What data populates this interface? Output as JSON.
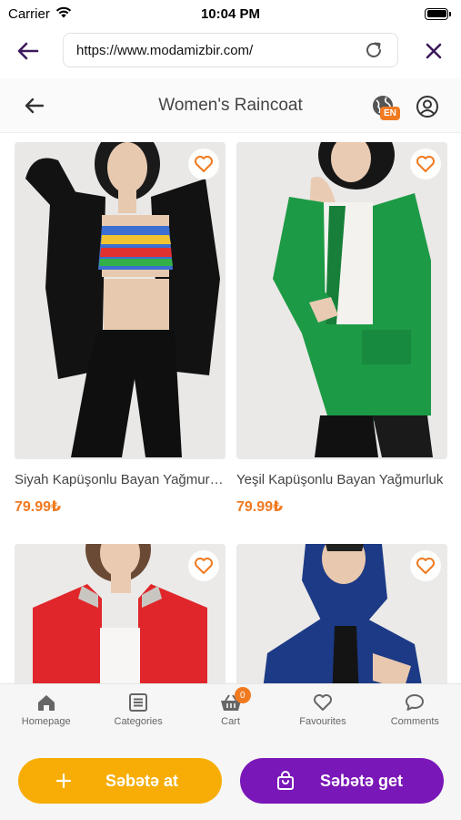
{
  "status_bar": {
    "carrier": "Carrier",
    "time": "10:04 PM"
  },
  "browser": {
    "url": "https://www.modamizbir.com/"
  },
  "header": {
    "title": "Women's Raincoat",
    "language_badge": "EN"
  },
  "products": [
    {
      "name": "Siyah Kapüşonlu Bayan Yağmurluk",
      "price": "79.99₺",
      "color": "#111111"
    },
    {
      "name": "Yeşil Kapüşonlu Bayan Yağmurluk",
      "price": "79.99₺",
      "color": "#1f9e4a"
    },
    {
      "name": "",
      "price": "",
      "color": "#e0262a"
    },
    {
      "name": "",
      "price": "",
      "color": "#1c3a86"
    }
  ],
  "tabbar": {
    "items": [
      {
        "label": "Homepage",
        "icon": "home-icon"
      },
      {
        "label": "Categories",
        "icon": "list-icon"
      },
      {
        "label": "Cart",
        "icon": "basket-icon"
      },
      {
        "label": "Favourites",
        "icon": "heart-icon"
      },
      {
        "label": "Comments",
        "icon": "chat-icon"
      }
    ],
    "cart_count": "0"
  },
  "actions": {
    "add_to_cart": "Səbətə at",
    "go_to_cart": "Səbətə get"
  },
  "colors": {
    "accent_orange": "#f07a20",
    "add_button": "#f7ad05",
    "get_button": "#7a17b8",
    "brand_dark": "#3d1a5c"
  }
}
